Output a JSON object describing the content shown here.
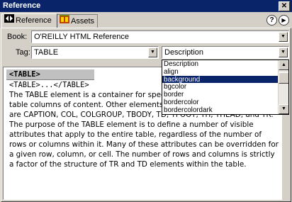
{
  "window": {
    "title": "Reference"
  },
  "tabs": [
    {
      "label": "Reference",
      "icon": "reference-tab-icon",
      "active": true
    },
    {
      "label": "Assets",
      "icon": "assets-tab-icon",
      "active": false
    }
  ],
  "help_icon": "?",
  "book": {
    "label": "Book:",
    "value": "O'REILLY HTML Reference"
  },
  "tag": {
    "label": "Tag:",
    "value": "TABLE"
  },
  "attribute": {
    "value": "Description"
  },
  "dropdown": {
    "items": [
      "Description",
      "align",
      "background",
      "bgcolor",
      "border",
      "bordercolor",
      "bordercolordark"
    ],
    "selected_index": 2,
    "scroll_position": 0.1
  },
  "content": {
    "heading": "<TABLE>",
    "syntax": "<TABLE>...</TABLE>",
    "body": "The TABLE element is a container for specify the content for a table. A table columns of content. Other elements related to the TABLE element are CAPTION, COL, COLGROUP, TBODY, TD, TFOOT, TH, THEAD, and TR. The purpose of the TABLE element is to define a number of visible attributes that apply to the entire table, regardless of the number of rows or columns within it. Many of these attributes can be overridden for a given row, column, or cell. The number of rows and columns is strictly a factor of the structure of TR and TD elements within the table."
  },
  "colors": {
    "titlebar": "#0a246a",
    "selection": "#0a246a",
    "face": "#d4d0c8"
  }
}
